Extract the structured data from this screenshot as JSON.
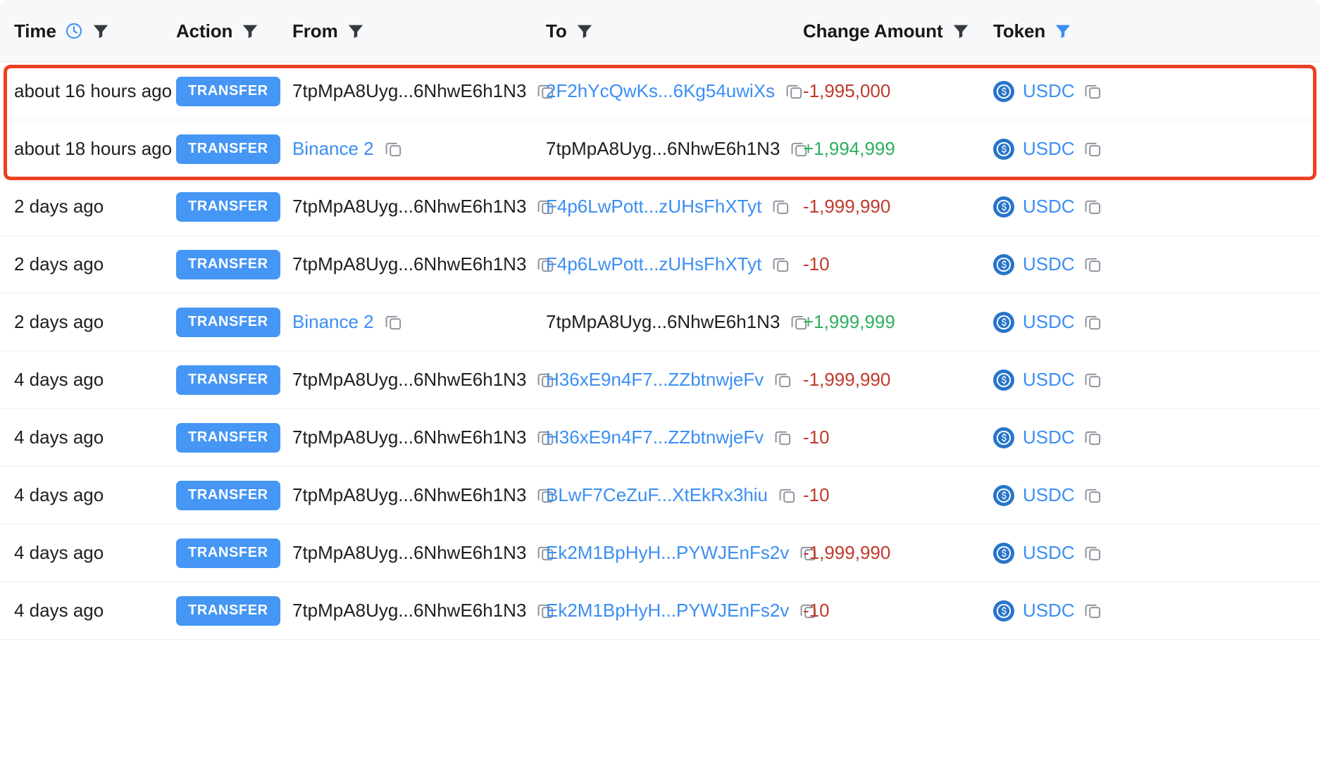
{
  "table": {
    "columns": [
      {
        "key": "time",
        "label": "Time",
        "has_clock_icon": true,
        "filter_active": false
      },
      {
        "key": "action",
        "label": "Action",
        "has_clock_icon": false,
        "filter_active": false
      },
      {
        "key": "from",
        "label": "From",
        "has_clock_icon": false,
        "filter_active": false
      },
      {
        "key": "to",
        "label": "To",
        "has_clock_icon": false,
        "filter_active": false
      },
      {
        "key": "amount",
        "label": "Change Amount",
        "has_clock_icon": false,
        "filter_active": false
      },
      {
        "key": "token",
        "label": "Token",
        "has_clock_icon": false,
        "filter_active": true
      }
    ],
    "rows": [
      {
        "time": "about 16 hours ago",
        "action": "TRANSFER",
        "from": "7tpMpA8Uyg...6NhwE6h1N3",
        "from_is_link": false,
        "to": "2F2hYcQwKs...6Kg54uwiXs",
        "to_is_link": true,
        "amount": "-1,995,000",
        "amount_sign": "negative",
        "token": "USDC",
        "highlighted": true
      },
      {
        "time": "about 18 hours ago",
        "action": "TRANSFER",
        "from": "Binance 2",
        "from_is_link": true,
        "to": "7tpMpA8Uyg...6NhwE6h1N3",
        "to_is_link": false,
        "amount": "+1,994,999",
        "amount_sign": "positive",
        "token": "USDC",
        "highlighted": true
      },
      {
        "time": "2 days ago",
        "action": "TRANSFER",
        "from": "7tpMpA8Uyg...6NhwE6h1N3",
        "from_is_link": false,
        "to": "F4p6LwPott...zUHsFhXTyt",
        "to_is_link": true,
        "amount": "-1,999,990",
        "amount_sign": "negative",
        "token": "USDC",
        "highlighted": false
      },
      {
        "time": "2 days ago",
        "action": "TRANSFER",
        "from": "7tpMpA8Uyg...6NhwE6h1N3",
        "from_is_link": false,
        "to": "F4p6LwPott...zUHsFhXTyt",
        "to_is_link": true,
        "amount": "-10",
        "amount_sign": "negative",
        "token": "USDC",
        "highlighted": false
      },
      {
        "time": "2 days ago",
        "action": "TRANSFER",
        "from": "Binance 2",
        "from_is_link": true,
        "to": "7tpMpA8Uyg...6NhwE6h1N3",
        "to_is_link": false,
        "amount": "+1,999,999",
        "amount_sign": "positive",
        "token": "USDC",
        "highlighted": false
      },
      {
        "time": "4 days ago",
        "action": "TRANSFER",
        "from": "7tpMpA8Uyg...6NhwE6h1N3",
        "from_is_link": false,
        "to": "H36xE9n4F7...ZZbtnwjeFv",
        "to_is_link": true,
        "amount": "-1,999,990",
        "amount_sign": "negative",
        "token": "USDC",
        "highlighted": false
      },
      {
        "time": "4 days ago",
        "action": "TRANSFER",
        "from": "7tpMpA8Uyg...6NhwE6h1N3",
        "from_is_link": false,
        "to": "H36xE9n4F7...ZZbtnwjeFv",
        "to_is_link": true,
        "amount": "-10",
        "amount_sign": "negative",
        "token": "USDC",
        "highlighted": false
      },
      {
        "time": "4 days ago",
        "action": "TRANSFER",
        "from": "7tpMpA8Uyg...6NhwE6h1N3",
        "from_is_link": false,
        "to": "BLwF7CeZuF...XtEkRx3hiu",
        "to_is_link": true,
        "amount": "-10",
        "amount_sign": "negative",
        "token": "USDC",
        "highlighted": false
      },
      {
        "time": "4 days ago",
        "action": "TRANSFER",
        "from": "7tpMpA8Uyg...6NhwE6h1N3",
        "from_is_link": false,
        "to": "Ek2M1BpHyH...PYWJEnFs2v",
        "to_is_link": true,
        "amount": "-1,999,990",
        "amount_sign": "negative",
        "token": "USDC",
        "highlighted": false
      },
      {
        "time": "4 days ago",
        "action": "TRANSFER",
        "from": "7tpMpA8Uyg...6NhwE6h1N3",
        "from_is_link": false,
        "to": "Ek2M1BpHyH...PYWJEnFs2v",
        "to_is_link": true,
        "amount": "-10",
        "amount_sign": "negative",
        "token": "USDC",
        "highlighted": false
      }
    ]
  },
  "colors": {
    "header_bg": "#f7f8f9",
    "badge_blue": "#4596f5",
    "link_blue": "#3b8ef3",
    "filter_active_blue": "#3b8ef3",
    "amount_negative": "#c0392b",
    "amount_positive": "#2eaf5d",
    "highlight_border": "#ef3f23",
    "row_divider": "#eef0f2",
    "usdc_icon": "#2775ca"
  },
  "icons": {
    "clock": "clock-icon",
    "filter": "filter-icon",
    "copy": "copy-icon",
    "token_logo": "usdc-coin-icon"
  },
  "annotation": {
    "highlight_row_indices": [
      0,
      1
    ]
  }
}
